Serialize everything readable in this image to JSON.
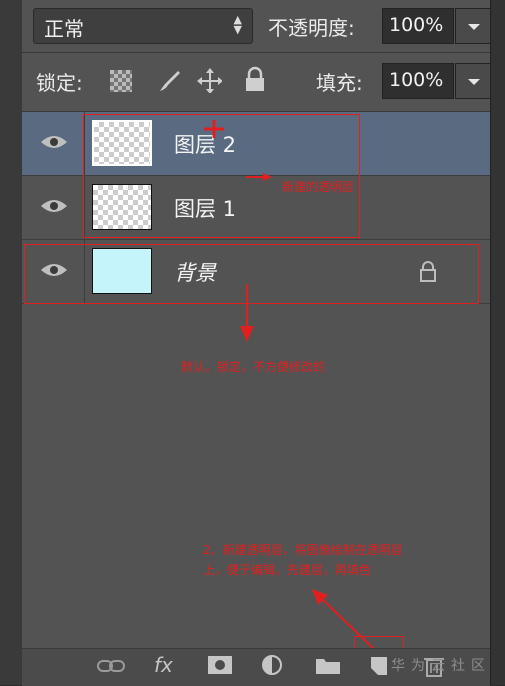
{
  "toolbar": {
    "blend_mode": "正常",
    "opacity_label": "不透明度:",
    "opacity_value": "100%",
    "lock_label": "锁定:",
    "fill_label": "填充:",
    "fill_value": "100%"
  },
  "layers": [
    {
      "name": "图层 2",
      "visible": true,
      "selected": true,
      "thumb": "transparent"
    },
    {
      "name": "图层 1",
      "visible": true,
      "selected": false,
      "thumb": "transparent"
    },
    {
      "name": "背景",
      "visible": true,
      "selected": false,
      "thumb": "cyan",
      "locked": true
    }
  ],
  "annotations": {
    "new_layer": "新建的透明层",
    "default_locked": "默认，锁定，不方便修改的",
    "note_line1": "2、新建透明层，将图像绘制在透明层",
    "note_line2": "上，便于编辑。先建层，再填色"
  },
  "bottom_icons": [
    "link-icon",
    "fx-icon",
    "mask-icon",
    "adjustment-icon",
    "folder-icon",
    "new-layer-icon",
    "trash-icon"
  ],
  "fx_label": "fx",
  "watermark": "华为云社区",
  "colors": {
    "annotation_red": "#e02020",
    "selected_row": "#5a6a80",
    "bg_thumb": "#c6f4fb"
  }
}
